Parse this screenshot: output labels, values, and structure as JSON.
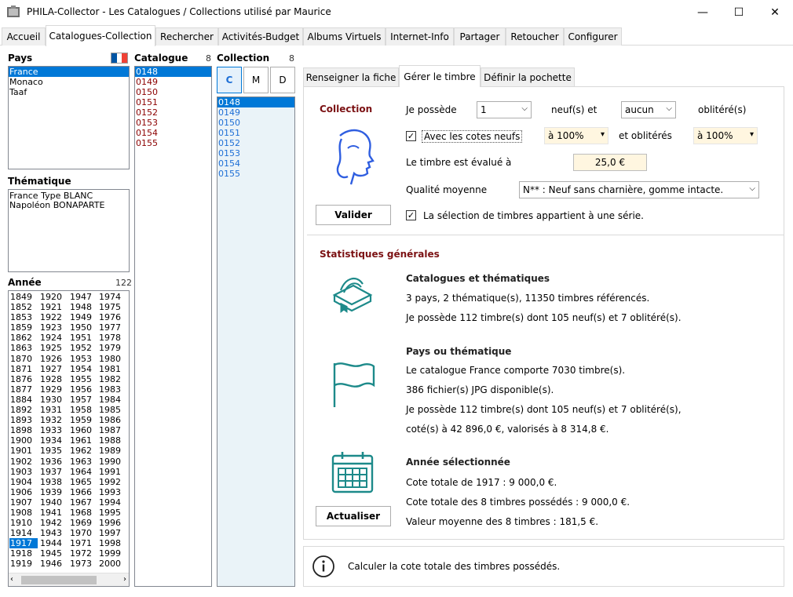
{
  "window": {
    "title": "PHILA-Collector - Les Catalogues / Collections utilisé par Maurice",
    "minimize": "—",
    "maximize": "☐",
    "close": "✕"
  },
  "main_tabs": [
    "Accueil",
    "Catalogues-Collection",
    "Rechercher",
    "Activités-Budget",
    "Albums Virtuels",
    "Internet-Info",
    "Partager",
    "Retoucher",
    "Configurer"
  ],
  "pays": {
    "label": "Pays",
    "items": [
      "France",
      "Monaco",
      "Taaf"
    ],
    "selected": "France"
  },
  "thematique": {
    "label": "Thématique",
    "items": [
      "France Type BLANC",
      "Napoléon BONAPARTE"
    ]
  },
  "annee": {
    "label": "Année",
    "count": "122",
    "columns": [
      [
        "1849",
        "1852",
        "1853",
        "1859",
        "1862",
        "1863",
        "1870",
        "1871",
        "1876",
        "1877",
        "1884",
        "1892",
        "1893",
        "1898",
        "1900",
        "1901",
        "1902",
        "1903",
        "1904",
        "1906",
        "1907",
        "1908",
        "1910",
        "1914",
        "1917",
        "1918",
        "1919"
      ],
      [
        "1920",
        "1921",
        "1922",
        "1923",
        "1924",
        "1925",
        "1926",
        "1927",
        "1928",
        "1929",
        "1930",
        "1931",
        "1932",
        "1933",
        "1934",
        "1935",
        "1936",
        "1937",
        "1938",
        "1939",
        "1940",
        "1941",
        "1942",
        "1943",
        "1944",
        "1945",
        "1946"
      ],
      [
        "1947",
        "1948",
        "1949",
        "1950",
        "1951",
        "1952",
        "1953",
        "1954",
        "1955",
        "1956",
        "1957",
        "1958",
        "1959",
        "1960",
        "1961",
        "1962",
        "1963",
        "1964",
        "1965",
        "1966",
        "1967",
        "1968",
        "1969",
        "1970",
        "1971",
        "1972",
        "1973"
      ],
      [
        "1974",
        "1975",
        "1976",
        "1977",
        "1978",
        "1979",
        "1980",
        "1981",
        "1982",
        "1983",
        "1984",
        "1985",
        "1986",
        "1987",
        "1988",
        "1989",
        "1990",
        "1991",
        "1992",
        "1993",
        "1994",
        "1995",
        "1996",
        "1997",
        "1998",
        "1999",
        "2000"
      ]
    ],
    "selected": "1917"
  },
  "catalogue": {
    "label": "Catalogue",
    "count": "8",
    "items": [
      "0148",
      "0149",
      "0150",
      "0151",
      "0152",
      "0153",
      "0154",
      "0155"
    ],
    "selected": "0148"
  },
  "collection": {
    "label": "Collection",
    "count": "8",
    "buttons": [
      "C",
      "M",
      "D"
    ],
    "items": [
      "0148",
      "0149",
      "0150",
      "0151",
      "0152",
      "0153",
      "0154",
      "0155"
    ],
    "selected": "0148"
  },
  "sub_tabs": [
    "Renseigner la fiche",
    "Gérer le timbre",
    "Définir la pochette"
  ],
  "gerer": {
    "collection_label": "Collection",
    "je_possede": "Je possède",
    "qty_neuf": "1",
    "neuf_et": "neuf(s) et",
    "qty_oblit": "aucun",
    "oblitere": "oblitéré(s)",
    "avec_cotes": "Avec les cotes neufs",
    "pct_neufs": "à 100%",
    "et_obliteres": "et oblitérés",
    "pct_oblit": "à 100%",
    "evalue_label": "Le timbre est évalué à",
    "evalue_value": "25,0 €",
    "qualite_label": "Qualité moyenne",
    "qualite_value": "N** : Neuf sans charnière, gomme intacte.",
    "serie_label": "La sélection de timbres appartient à une série.",
    "valider": "Valider"
  },
  "stats": {
    "title": "Statistiques générales",
    "catalogues_title": "Catalogues et thématiques",
    "catalogues_l1": "3 pays, 2 thématique(s), 11350 timbres référencés.",
    "catalogues_l2": "Je possède 112 timbre(s) dont 105 neuf(s) et 7 oblitéré(s).",
    "pays_title": "Pays ou thématique",
    "pays_l1": "Le catalogue France comporte 7030 timbre(s).",
    "pays_l2": "386 fichier(s) JPG disponible(s).",
    "pays_l3": "Je possède 112 timbre(s) dont 105 neuf(s) et 7 oblitéré(s),",
    "pays_l4": "coté(s) à 42 896,0 €, valorisés à 8 314,8 €.",
    "annee_title": "Année sélectionnée",
    "annee_l1": "Cote totale de 1917 : 9 000,0 €.",
    "annee_l2": "Cote totale des 8 timbres possédés : 9 000,0 €.",
    "annee_l3": "Valeur moyenne des 8 timbres : 181,5 €.",
    "actualiser": "Actualiser"
  },
  "info": {
    "text": "Calculer la cote totale des timbres possédés."
  },
  "colors": {
    "accent": "#0078d7",
    "dark_red": "#7b1113",
    "teal": "#1d8a8a"
  }
}
